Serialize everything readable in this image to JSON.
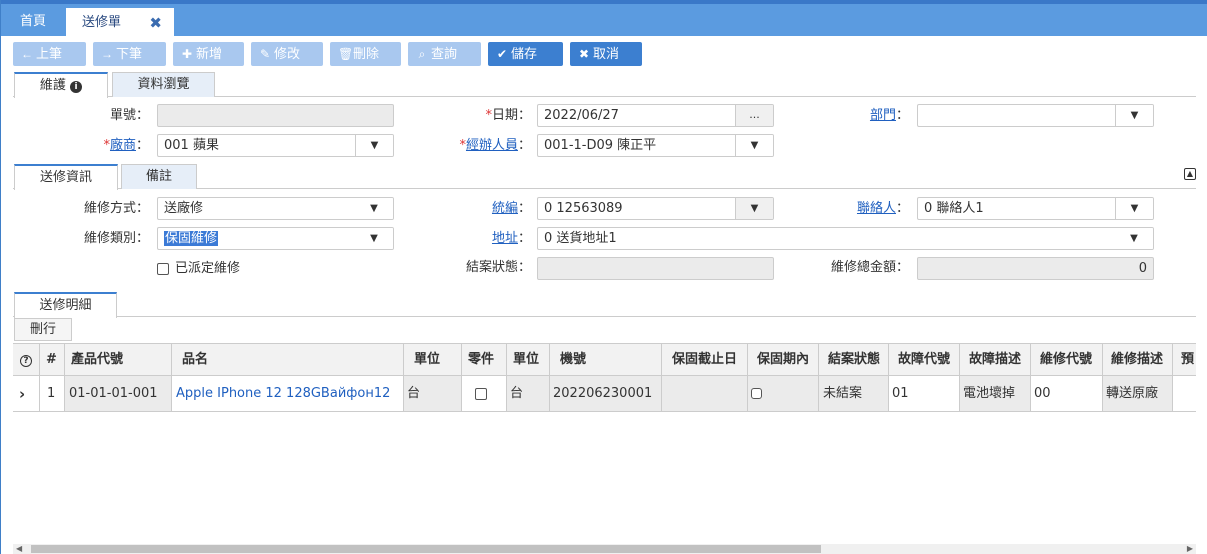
{
  "tabs": {
    "home": "首頁",
    "active": "送修單"
  },
  "toolbar": {
    "prev": "上筆",
    "next": "下筆",
    "add": "新增",
    "edit": "修改",
    "delete": "刪除",
    "query": "查詢",
    "save": "儲存",
    "cancel": "取消"
  },
  "maintabs": {
    "maintain": "維護",
    "browse": "資料瀏覽"
  },
  "header": {
    "doc_no_label": "單號：",
    "doc_no": "",
    "date_label": "日期",
    "date": "2022/06/27",
    "date_btn": "...",
    "dept_label": "部門",
    "dept": "",
    "vendor_label": "廠商",
    "vendor": "001 蘋果",
    "handler_label": "經辦人員",
    "handler": "001-1-D09 陳正平"
  },
  "infotabs": {
    "repair_info": "送修資訊",
    "notes": "備註"
  },
  "info": {
    "method_label": "維修方式：",
    "method": "送廠修",
    "taxid_label": "統編",
    "taxid": "0 12563089",
    "contact_label": "聯絡人",
    "contact": "0 聯絡人1",
    "type_label": "維修類別：",
    "type": "保固維修",
    "address_label": "地址",
    "address": "0 送貨地址1",
    "dispatched_label": "已派定維修",
    "status_label": "結案狀態：",
    "status": "",
    "total_label": "維修總金額：",
    "total": "0"
  },
  "detail": {
    "tab": "送修明細",
    "delete_row": "刪行"
  },
  "grid": {
    "headers": [
      "",
      "#",
      "產品代號",
      "品名",
      "單位",
      "零件",
      "單位",
      "機號",
      "保固截止日",
      "保固期內",
      "結案狀態",
      "故障代號",
      "故障描述",
      "維修代號",
      "維修描述",
      "預"
    ],
    "row": {
      "num": "1",
      "code": "01-01-01-001",
      "name": "Apple IPhone 12 128GВайфон12",
      "unit": "台",
      "unit2": "台",
      "serial": "202206230001",
      "warranty_end": "",
      "status": "未結案",
      "fault_code": "01",
      "fault_desc": "電池壞掉",
      "repair_code": "00",
      "repair_desc": "轉送原廠"
    }
  }
}
